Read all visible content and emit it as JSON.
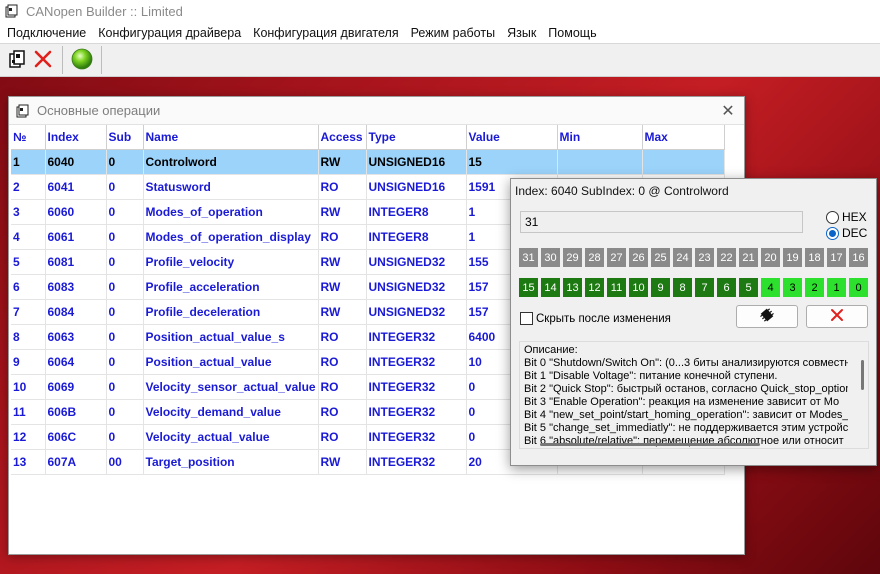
{
  "app": {
    "title": "CANopen Builder :: Limited"
  },
  "menu": [
    "Подключение",
    "Конфигурация драйвера",
    "Конфигурация двигателя",
    "Режим работы",
    "Язык",
    "Помощь"
  ],
  "toolbar": {
    "icons": [
      "connect-icon",
      "close-x-icon",
      "green-ball-icon"
    ]
  },
  "ops_window": {
    "title": "Основные операции",
    "columns": [
      "№",
      "Index",
      "Sub",
      "Name",
      "Access",
      "Type",
      "Value",
      "Min",
      "Max"
    ],
    "rows": [
      [
        "1",
        "6040",
        "0",
        "Controlword",
        "RW",
        "UNSIGNED16",
        "15",
        "",
        ""
      ],
      [
        "2",
        "6041",
        "0",
        "Statusword",
        "RO",
        "UNSIGNED16",
        "1591",
        "",
        ""
      ],
      [
        "3",
        "6060",
        "0",
        "Modes_of_operation",
        "RW",
        "INTEGER8",
        "1",
        "",
        ""
      ],
      [
        "4",
        "6061",
        "0",
        "Modes_of_operation_display",
        "RO",
        "INTEGER8",
        "1",
        "",
        ""
      ],
      [
        "5",
        "6081",
        "0",
        "Profile_velocity",
        "RW",
        "UNSIGNED32",
        "155",
        "",
        ""
      ],
      [
        "6",
        "6083",
        "0",
        "Profile_acceleration",
        "RW",
        "UNSIGNED32",
        "157",
        "",
        ""
      ],
      [
        "7",
        "6084",
        "0",
        "Profile_deceleration",
        "RW",
        "UNSIGNED32",
        "157",
        "",
        ""
      ],
      [
        "8",
        "6063",
        "0",
        "Position_actual_value_s",
        "RO",
        "INTEGER32",
        "6400",
        "",
        ""
      ],
      [
        "9",
        "6064",
        "0",
        "Position_actual_value",
        "RO",
        "INTEGER32",
        "10",
        "",
        ""
      ],
      [
        "10",
        "6069",
        "0",
        "Velocity_sensor_actual_value",
        "RO",
        "INTEGER32",
        "0",
        "",
        ""
      ],
      [
        "11",
        "606B",
        "0",
        "Velocity_demand_value",
        "RO",
        "INTEGER32",
        "0",
        "",
        ""
      ],
      [
        "12",
        "606C",
        "0",
        "Velocity_actual_value",
        "RO",
        "INTEGER32",
        "0",
        "",
        ""
      ],
      [
        "13",
        "607A",
        "00",
        "Target_position",
        "RW",
        "INTEGER32",
        "20",
        "",
        ""
      ]
    ],
    "selected_row": 0
  },
  "edit_window": {
    "title": "Index: 6040 SubIndex: 0 @ Controlword",
    "value": "31",
    "radio_hex": "HEX",
    "radio_dec": "DEC",
    "selected_radio": "DEC",
    "bits_high": [
      "31",
      "30",
      "29",
      "28",
      "27",
      "26",
      "25",
      "24",
      "23",
      "22",
      "21",
      "20",
      "19",
      "18",
      "17",
      "16"
    ],
    "bits_low": [
      "15",
      "14",
      "13",
      "12",
      "11",
      "10",
      "9",
      "8",
      "7",
      "6",
      "5",
      "4",
      "3",
      "2",
      "1",
      "0"
    ],
    "bits_low_set": [
      "4",
      "3",
      "2",
      "1",
      "0"
    ],
    "checkbox_label": "Скрыть после изменения",
    "description_lines": [
      "Описание:",
      "Bit 0 \"Shutdown/Switch On\": (0...3 биты анализируются совместно",
      "Bit 1 \"Disable Voltage\": питание конечной ступени.",
      "Bit 2 \"Quick Stop\": быстрый останов, согласно Quick_stop_option",
      "Bit 3 \"Enable Operation\": реакция на изменение зависит от Mo",
      "Bit 4 \"new_set_point/start_homing_operation\": зависит от Modes_",
      "Bit 5 \"change_set_immediatly\": не поддерживается этим устройс",
      "Bit 6 \"absolute/relative\": перемещение абсолютное или относит"
    ]
  }
}
